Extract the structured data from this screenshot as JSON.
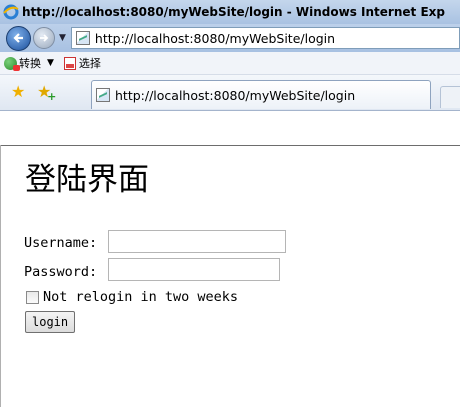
{
  "window": {
    "title": "http://localhost:8080/myWebSite/login - Windows Internet Exp"
  },
  "address_bar": {
    "url": "http://localhost:8080/myWebSite/login"
  },
  "command_bar": {
    "translate_label": "转换",
    "select_label": "选择"
  },
  "tab": {
    "label": "http://localhost:8080/myWebSite/login"
  },
  "page": {
    "heading": "登陆界面",
    "username_label": "Username:",
    "username_value": "",
    "password_label": "Password:",
    "password_value": "",
    "remember_label": "Not relogin in two weeks",
    "remember_checked": false,
    "login_button": "login"
  },
  "colors": {
    "chrome_accent": "#a9c2e2",
    "back_button": "#1b4f9c"
  }
}
